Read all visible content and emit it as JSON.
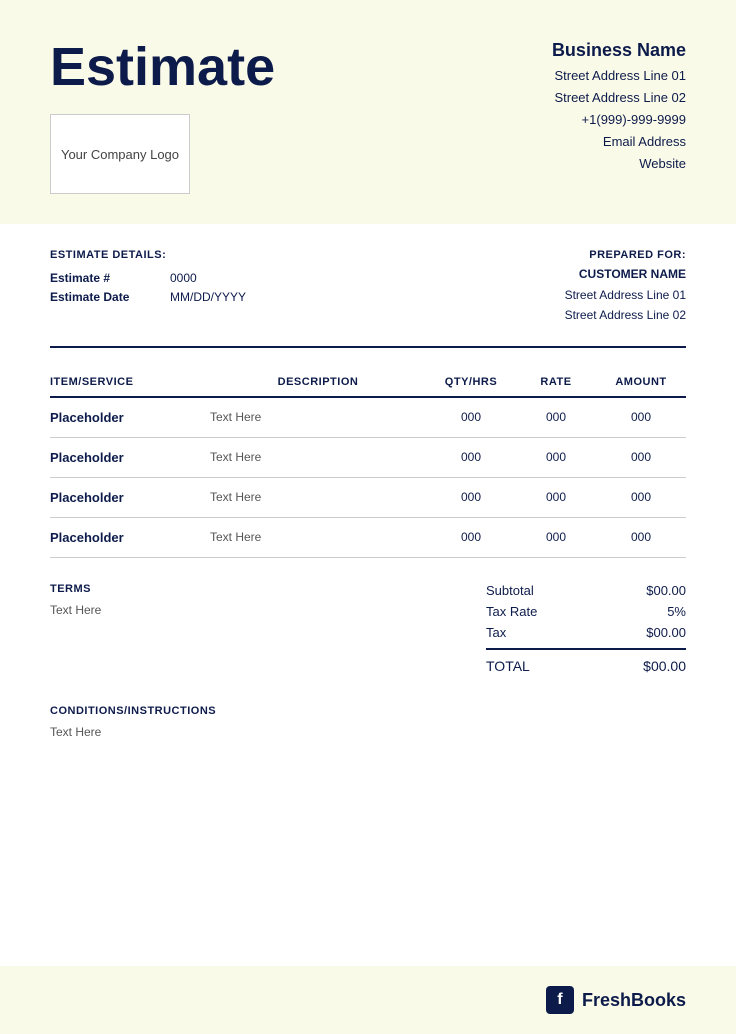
{
  "header": {
    "title": "Estimate",
    "logo_text": "Your Company Logo",
    "business": {
      "name": "Business Name",
      "address1": "Street Address Line 01",
      "address2": "Street Address Line 02",
      "phone": "+1(999)-999-9999",
      "email": "Email Address",
      "website": "Website"
    }
  },
  "estimate_details": {
    "section_label": "ESTIMATE DETAILS:",
    "number_label": "Estimate #",
    "number_value": "0000",
    "date_label": "Estimate Date",
    "date_value": "MM/DD/YYYY"
  },
  "prepared_for": {
    "label": "PREPARED FOR:",
    "customer_name": "CUSTOMER NAME",
    "address1": "Street Address Line 01",
    "address2": "Street Address Line 02"
  },
  "table": {
    "headers": [
      "ITEM/SERVICE",
      "DESCRIPTION",
      "QTY/HRS",
      "RATE",
      "AMOUNT"
    ],
    "rows": [
      {
        "item": "Placeholder",
        "description": "Text Here",
        "qty": "000",
        "rate": "000",
        "amount": "000"
      },
      {
        "item": "Placeholder",
        "description": "Text Here",
        "qty": "000",
        "rate": "000",
        "amount": "000"
      },
      {
        "item": "Placeholder",
        "description": "Text Here",
        "qty": "000",
        "rate": "000",
        "amount": "000"
      },
      {
        "item": "Placeholder",
        "description": "Text Here",
        "qty": "000",
        "rate": "000",
        "amount": "000"
      }
    ]
  },
  "terms": {
    "label": "TERMS",
    "text": "Text Here"
  },
  "totals": {
    "subtotal_label": "Subtotal",
    "subtotal_value": "$00.00",
    "tax_rate_label": "Tax Rate",
    "tax_rate_value": "5%",
    "tax_label": "Tax",
    "tax_value": "$00.00",
    "total_label": "TOTAL",
    "total_value": "$00.00"
  },
  "conditions": {
    "label": "CONDITIONS/INSTRUCTIONS",
    "text": "Text Here"
  },
  "footer": {
    "brand": "FreshBooks",
    "icon_letter": "f"
  }
}
